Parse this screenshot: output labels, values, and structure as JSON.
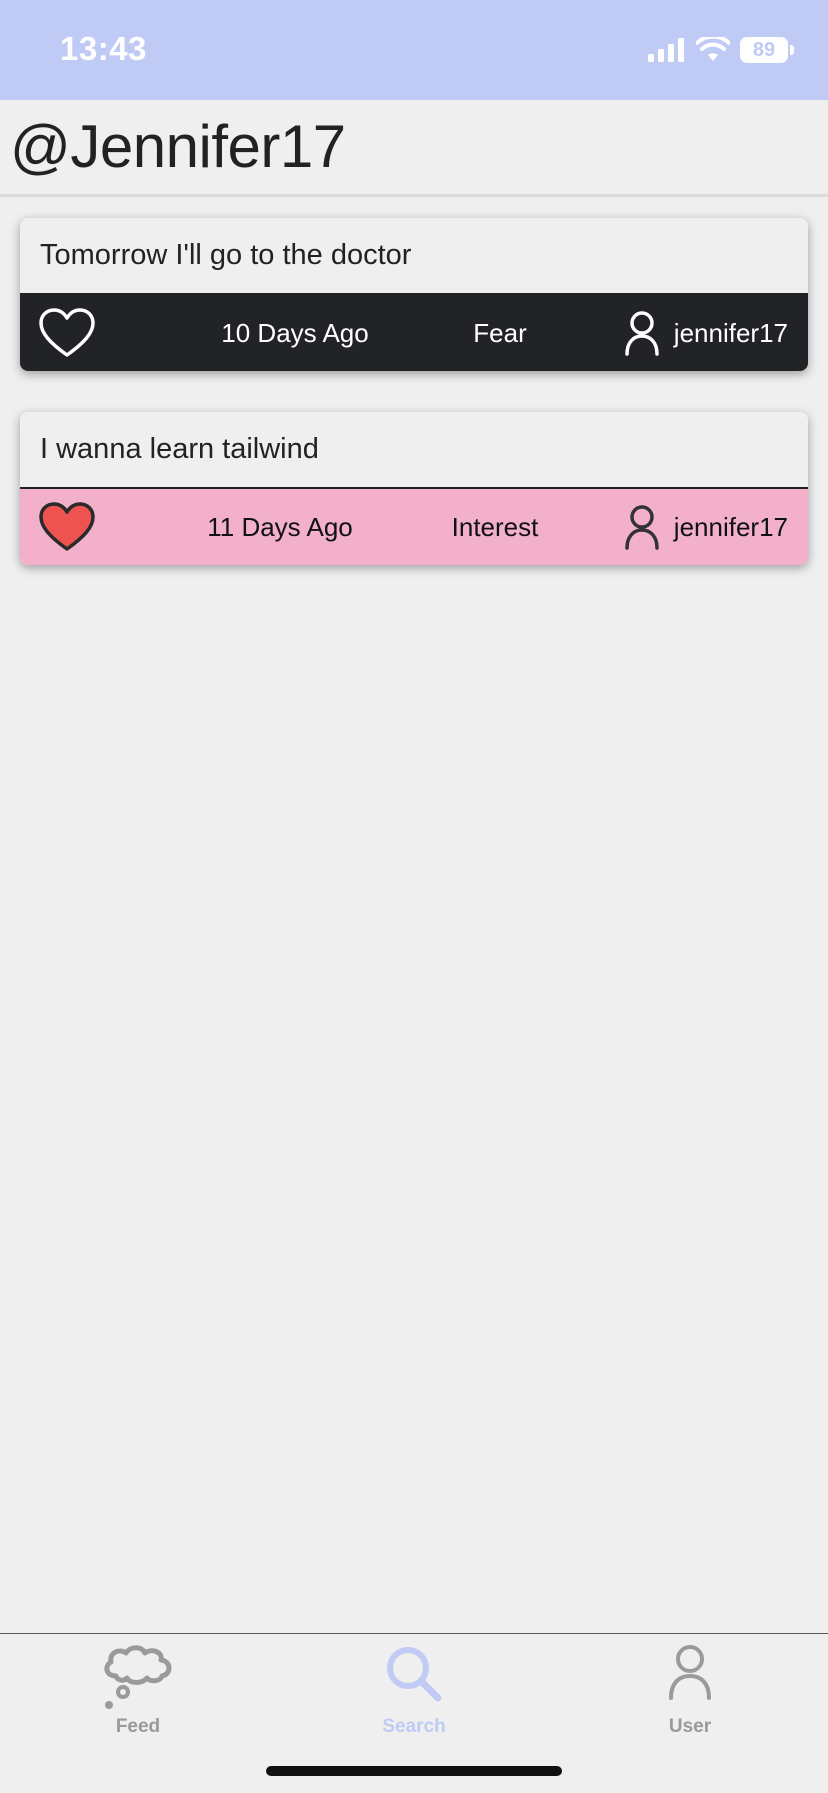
{
  "status_bar": {
    "time": "13:43",
    "battery": "89"
  },
  "header": {
    "title": "@Jennifer17"
  },
  "posts": [
    {
      "text": "Tomorrow I'll go to the doctor",
      "time_ago": "10 Days Ago",
      "emotion": "Fear",
      "author": "jennifer17",
      "liked": false,
      "theme_color": "#212327"
    },
    {
      "text": "I wanna learn tailwind",
      "time_ago": "11 Days Ago",
      "emotion": "Interest",
      "author": "jennifer17",
      "liked": true,
      "theme_color": "#f2b0cb"
    }
  ],
  "tabs": [
    {
      "label": "Feed",
      "icon": "thought-cloud-icon",
      "active": false
    },
    {
      "label": "Search",
      "icon": "search-icon",
      "active": true
    },
    {
      "label": "User",
      "icon": "user-icon",
      "active": false
    }
  ],
  "colors": {
    "status_bar": "#bfcbf5",
    "tab_active": "#bfcbf5",
    "tab_inactive": "#9a9a9a",
    "heart_fill": "#ef5350"
  }
}
